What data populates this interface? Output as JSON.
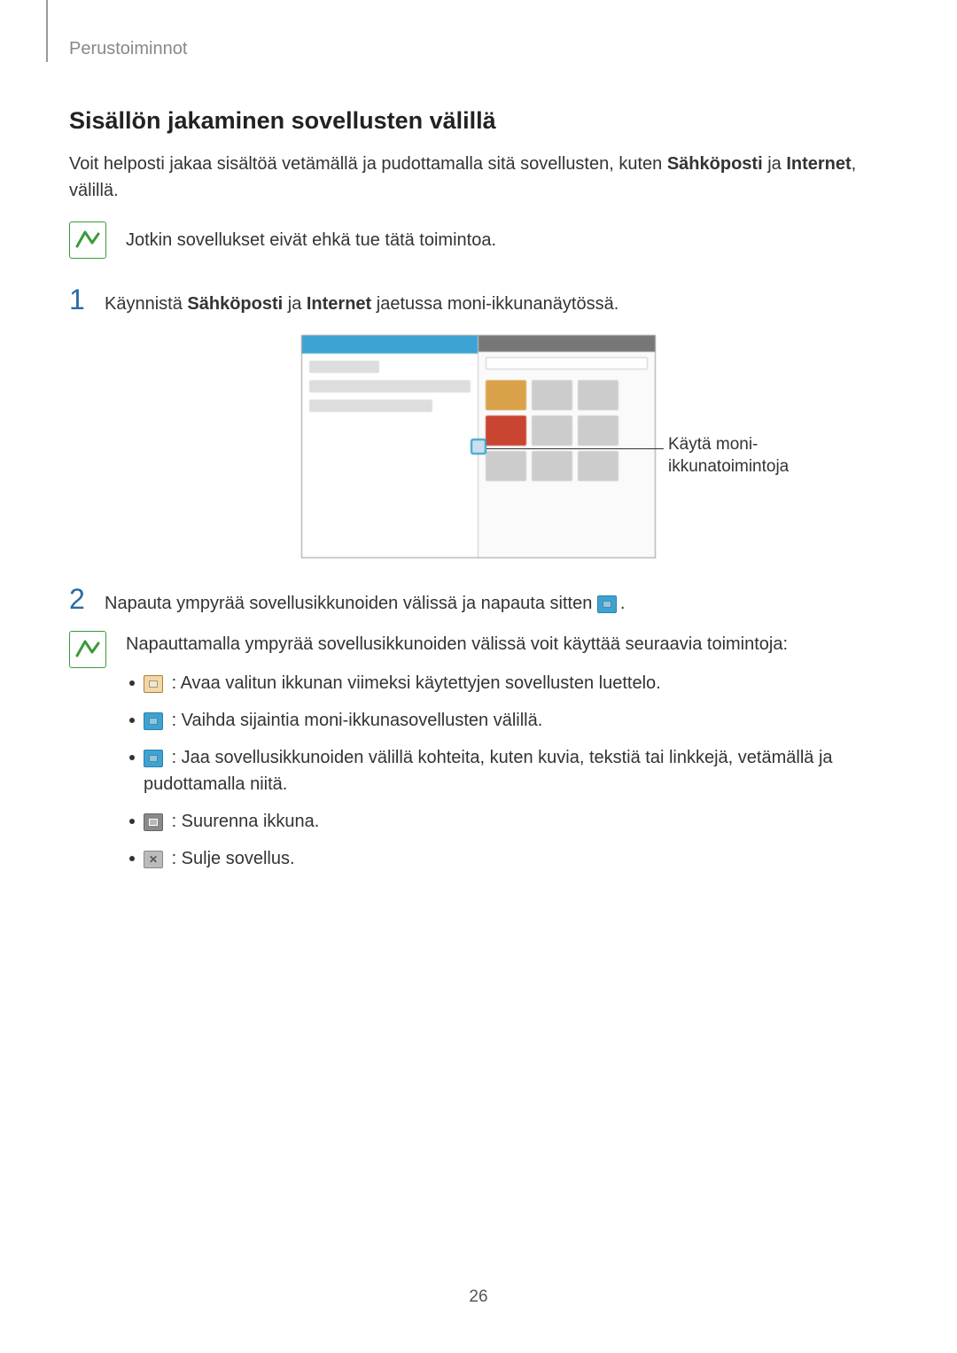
{
  "header": {
    "section": "Perustoiminnot"
  },
  "heading": "Sisällön jakaminen sovellusten välillä",
  "intro": {
    "pre": "Voit helposti jakaa sisältöä vetämällä ja pudottamalla sitä sovellusten, kuten ",
    "bold1": "Sähköposti",
    "mid": " ja ",
    "bold2": "Internet",
    "post": ", välillä."
  },
  "note1": "Jotkin sovellukset eivät ehkä tue tätä toimintoa.",
  "steps": [
    {
      "num": "1",
      "pre": "Käynnistä ",
      "bold1": "Sähköposti",
      "mid": " ja ",
      "bold2": "Internet",
      "post": " jaetussa moni-ikkunanäytössä."
    },
    {
      "num": "2",
      "text": "Napauta ympyrää sovellusikkunoiden välissä ja napauta sitten ",
      "tail": "."
    }
  ],
  "callout": "Käytä moni-ikkunatoimintoja",
  "note2": {
    "lead": "Napauttamalla ympyrää sovellusikkunoiden välissä voit käyttää seuraavia toimintoja:",
    "items": [
      ": Avaa valitun ikkunan viimeksi käytettyjen sovellusten luettelo.",
      ": Vaihda sijaintia moni-ikkunasovellusten välillä.",
      ": Jaa sovellusikkunoiden välillä kohteita, kuten kuvia, tekstiä tai linkkejä, vetämällä ja pudottamalla niitä.",
      ": Suurenna ikkuna.",
      ": Sulje sovellus."
    ]
  },
  "pageNumber": "26"
}
